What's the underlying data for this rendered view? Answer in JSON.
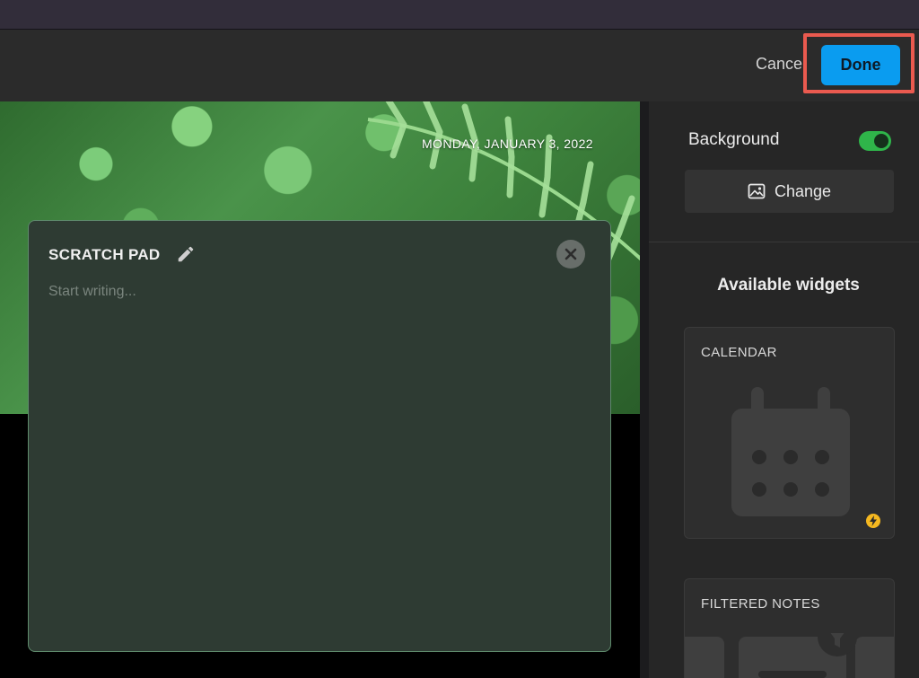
{
  "header": {
    "cancel_label": "Cancel",
    "done_label": "Done"
  },
  "canvas": {
    "date": "MONDAY, JANUARY 3, 2022"
  },
  "scratch_pad": {
    "title": "SCRATCH PAD",
    "placeholder": "Start writing..."
  },
  "sidebar": {
    "background_label": "Background",
    "background_enabled": true,
    "change_label": "Change",
    "widgets_heading": "Available widgets",
    "widgets": [
      {
        "title": "CALENDAR",
        "icon": "calendar-icon"
      },
      {
        "title": "FILTERED NOTES",
        "icon": "funnel-icon"
      }
    ]
  },
  "colors": {
    "accent": "#0a9cf0",
    "highlight": "#ea5a4f",
    "toggle_on": "#2fb54a",
    "pad_bg": "#2e3b33",
    "bolt": "#f5b820"
  },
  "icons": [
    "pencil-icon",
    "close-icon",
    "image-icon",
    "calendar-icon",
    "bolt-icon",
    "funnel-icon"
  ]
}
